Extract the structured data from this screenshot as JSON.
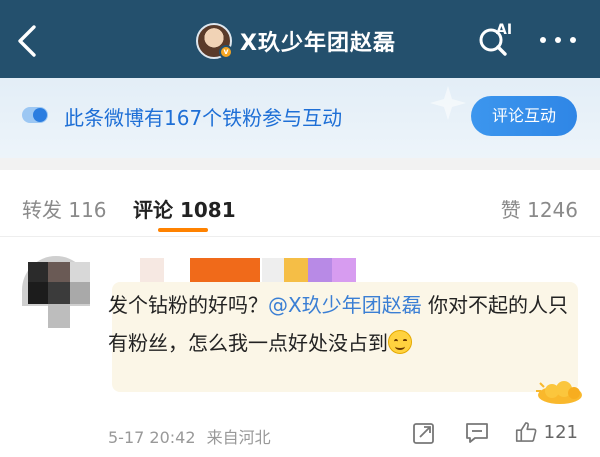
{
  "header": {
    "title": "玖少年团赵磊",
    "title_prefix": "X",
    "badge": "v",
    "ai_label": "AI",
    "background": "#24506d"
  },
  "banner": {
    "text": "此条微博有167个铁粉参与互动",
    "button_label": "评论互动",
    "accent": "#1e6fd6"
  },
  "tabs": {
    "repost": "转发 116",
    "comment": "评论 1081",
    "like": "赞 1246",
    "active": "comment",
    "underline_color": "#ff8200"
  },
  "comment": {
    "text_before": "发个钻粉的好吗？",
    "mention": "@X玖少年团赵磊",
    "text_after": " 你对不起的人只有粉丝，怎么我一点好处没占到",
    "emoji": "smile-emoji",
    "time": "5-17 20:42",
    "source": "来自河北",
    "like_count": "121",
    "name_redacted": true
  },
  "icons": [
    "back-icon",
    "ai-search-icon",
    "more-icon",
    "fan-interaction-icon",
    "repost-icon",
    "comment-icon",
    "like-icon"
  ]
}
